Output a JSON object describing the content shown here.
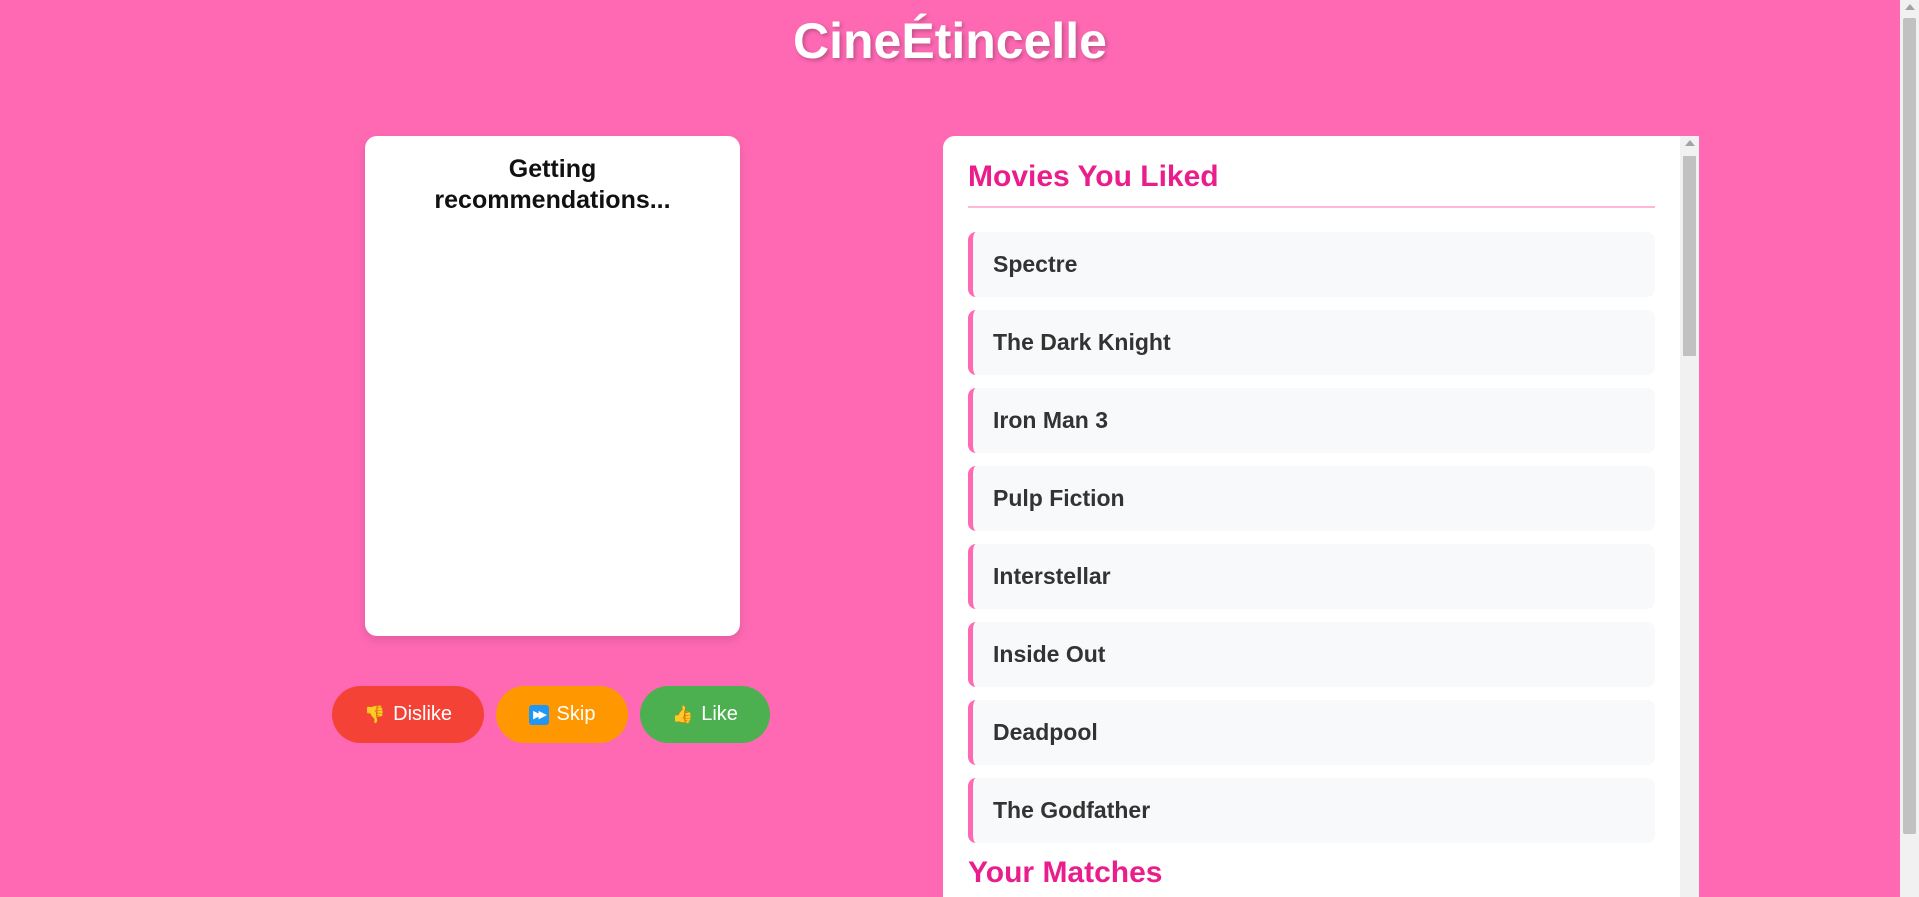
{
  "header": {
    "title": "CineÉtincelle"
  },
  "card": {
    "message": "Getting recommendations..."
  },
  "actions": {
    "dislike": {
      "icon": "👎",
      "label": "Dislike",
      "color": "#f44336"
    },
    "skip": {
      "icon": "⏭",
      "label": "Skip",
      "color": "#ff9800"
    },
    "like": {
      "icon": "👍",
      "label": "Like",
      "color": "#4caf50"
    }
  },
  "liked": {
    "title": "Movies You Liked",
    "items": [
      "Spectre",
      "The Dark Knight",
      "Iron Man 3",
      "Pulp Fiction",
      "Interstellar",
      "Inside Out",
      "Deadpool",
      "The Godfather"
    ]
  },
  "matches": {
    "title": "Your Matches"
  },
  "colors": {
    "background": "#ff69b4",
    "accent": "#e91e8c"
  }
}
